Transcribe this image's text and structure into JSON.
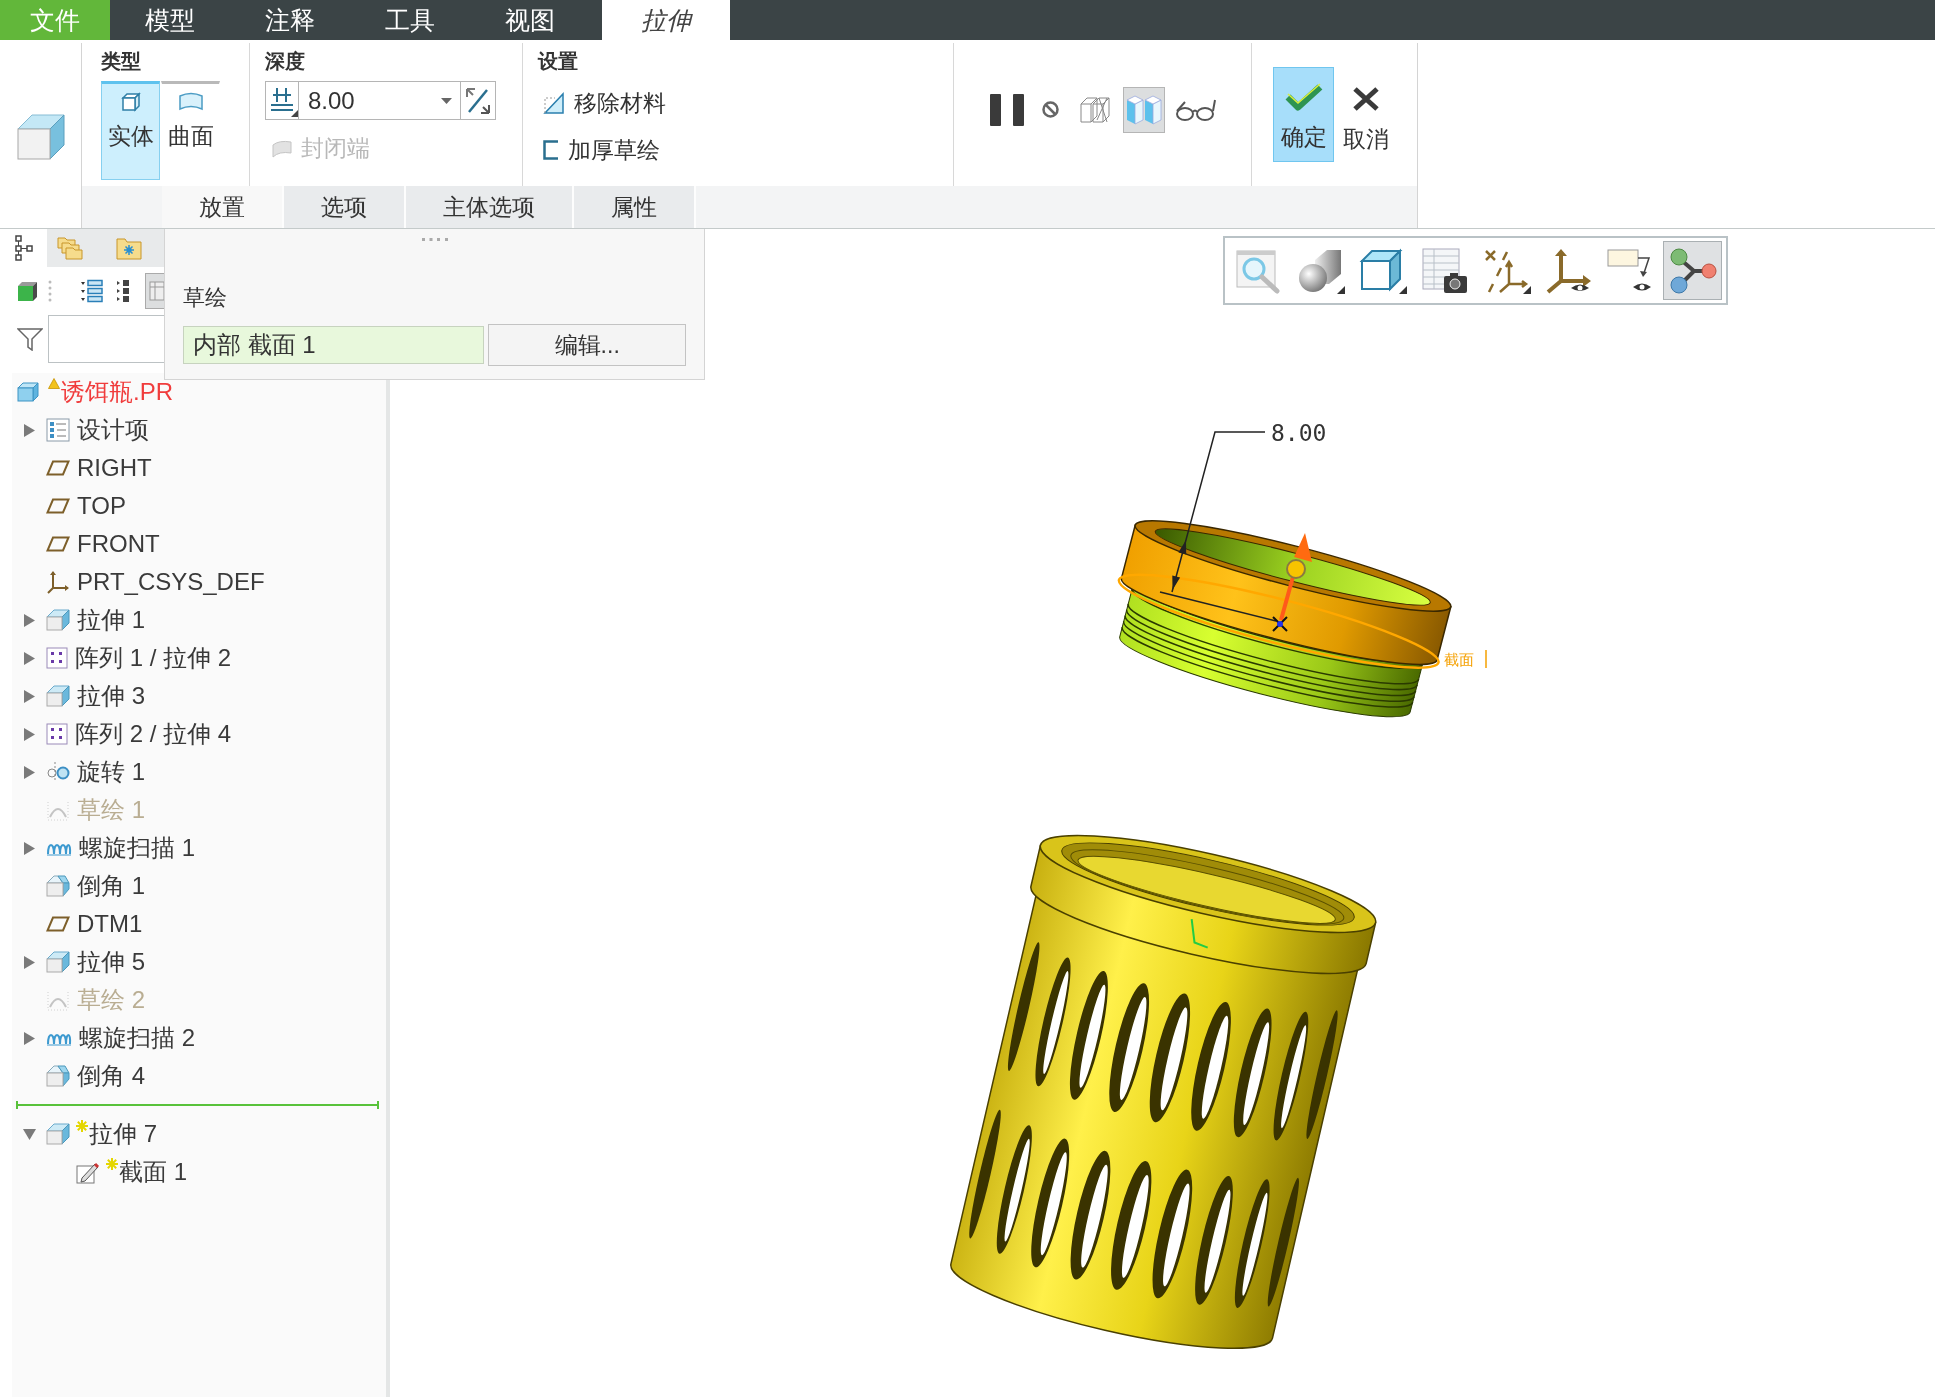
{
  "menu_tabs": [
    {
      "label": "文件",
      "kind": "file",
      "selected": false
    },
    {
      "label": "模型",
      "kind": "tab",
      "selected": false
    },
    {
      "label": "注释",
      "kind": "tab",
      "selected": false
    },
    {
      "label": "工具",
      "kind": "tab",
      "selected": false
    },
    {
      "label": "视图",
      "kind": "tab",
      "selected": false
    },
    {
      "label": "拉伸",
      "kind": "contextual",
      "selected": true
    }
  ],
  "ribbon": {
    "type_group": {
      "title": "类型",
      "options": [
        {
          "label": "实体",
          "kind": "solid",
          "selected": true
        },
        {
          "label": "曲面",
          "kind": "surface",
          "selected": false
        }
      ]
    },
    "depth_group": {
      "title": "深度",
      "value": "8.00",
      "capped_ends": {
        "label": "封闭端",
        "disabled": true
      }
    },
    "settings_group": {
      "title": "设置",
      "options": [
        {
          "label": "移除材料",
          "kind": "remove_material"
        },
        {
          "label": "加厚草绘",
          "kind": "thicken"
        }
      ]
    },
    "preview_tools": [
      {
        "kind": "pause",
        "pressed": false
      },
      {
        "kind": "no_preview",
        "pressed": false
      },
      {
        "kind": "geometry_preview",
        "pressed": false
      },
      {
        "kind": "feature_preview",
        "pressed": true
      },
      {
        "kind": "verify",
        "pressed": false
      }
    ],
    "actions": [
      {
        "label": "确定",
        "kind": "ok"
      },
      {
        "label": "取消",
        "kind": "cancel"
      }
    ],
    "tabs": [
      {
        "label": "放置",
        "selected": true
      },
      {
        "label": "选项",
        "selected": false
      },
      {
        "label": "主体选项",
        "selected": false
      },
      {
        "label": "属性",
        "selected": false
      }
    ]
  },
  "placement_panel": {
    "label": "草绘",
    "sketch_field": "内部 截面 1",
    "edit_button": "编辑..."
  },
  "navigator_tabs": [
    {
      "kind": "model_tree",
      "selected": true
    },
    {
      "kind": "folder_browser",
      "selected": false
    },
    {
      "kind": "favorites",
      "selected": false
    }
  ],
  "model_tree": {
    "root": {
      "label": "诱饵瓶.PR",
      "warning": true
    },
    "items": [
      {
        "label": "设计项",
        "kind": "design_items",
        "expanded": false,
        "hidden": false,
        "new": false
      },
      {
        "label": "RIGHT",
        "kind": "datum_plane",
        "hidden": false,
        "new": false
      },
      {
        "label": "TOP",
        "kind": "datum_plane",
        "hidden": false,
        "new": false
      },
      {
        "label": "FRONT",
        "kind": "datum_plane",
        "hidden": false,
        "new": false
      },
      {
        "label": "PRT_CSYS_DEF",
        "kind": "csys",
        "hidden": false,
        "new": false
      },
      {
        "label": "拉伸 1",
        "kind": "extrude",
        "expanded": false,
        "hidden": false,
        "new": false
      },
      {
        "label": "阵列 1 / 拉伸 2",
        "kind": "pattern",
        "expanded": false,
        "hidden": false,
        "new": false
      },
      {
        "label": "拉伸 3",
        "kind": "extrude",
        "expanded": false,
        "hidden": false,
        "new": false
      },
      {
        "label": "阵列 2 / 拉伸 4",
        "kind": "pattern",
        "expanded": false,
        "hidden": false,
        "new": false
      },
      {
        "label": "旋转 1",
        "kind": "revolve",
        "expanded": false,
        "hidden": false,
        "new": false
      },
      {
        "label": "草绘 1",
        "kind": "sketch",
        "hidden": true,
        "new": false
      },
      {
        "label": "螺旋扫描 1",
        "kind": "helical_sweep",
        "expanded": false,
        "hidden": false,
        "new": false
      },
      {
        "label": "倒角 1",
        "kind": "chamfer",
        "hidden": false,
        "new": false
      },
      {
        "label": "DTM1",
        "kind": "datum_plane",
        "hidden": false,
        "new": false
      },
      {
        "label": "拉伸 5",
        "kind": "extrude",
        "expanded": false,
        "hidden": false,
        "new": false
      },
      {
        "label": "草绘 2",
        "kind": "sketch",
        "hidden": true,
        "new": false
      },
      {
        "label": "螺旋扫描 2",
        "kind": "helical_sweep",
        "expanded": false,
        "hidden": false,
        "new": false
      },
      {
        "label": "倒角 4",
        "kind": "chamfer",
        "hidden": false,
        "new": false
      },
      {
        "kind": "insert_marker"
      },
      {
        "label": "拉伸 7",
        "kind": "extrude",
        "expanded": true,
        "hidden": false,
        "new": true,
        "children": [
          {
            "label": "截面 1",
            "kind": "section_sketch",
            "hidden": false,
            "new": true
          }
        ]
      }
    ]
  },
  "view_toolbar": [
    {
      "kind": "magnifier",
      "selected": false
    },
    {
      "kind": "shaded_shapes",
      "selected": false
    },
    {
      "kind": "cube",
      "selected": false
    },
    {
      "kind": "table_camera",
      "selected": false
    },
    {
      "kind": "datum_display",
      "selected": false
    },
    {
      "kind": "axes_eye",
      "selected": false
    },
    {
      "kind": "note_eye",
      "selected": false
    },
    {
      "kind": "nodes",
      "selected": true
    }
  ],
  "viewport": {
    "dimension": "8.00",
    "section_label": "截面"
  }
}
